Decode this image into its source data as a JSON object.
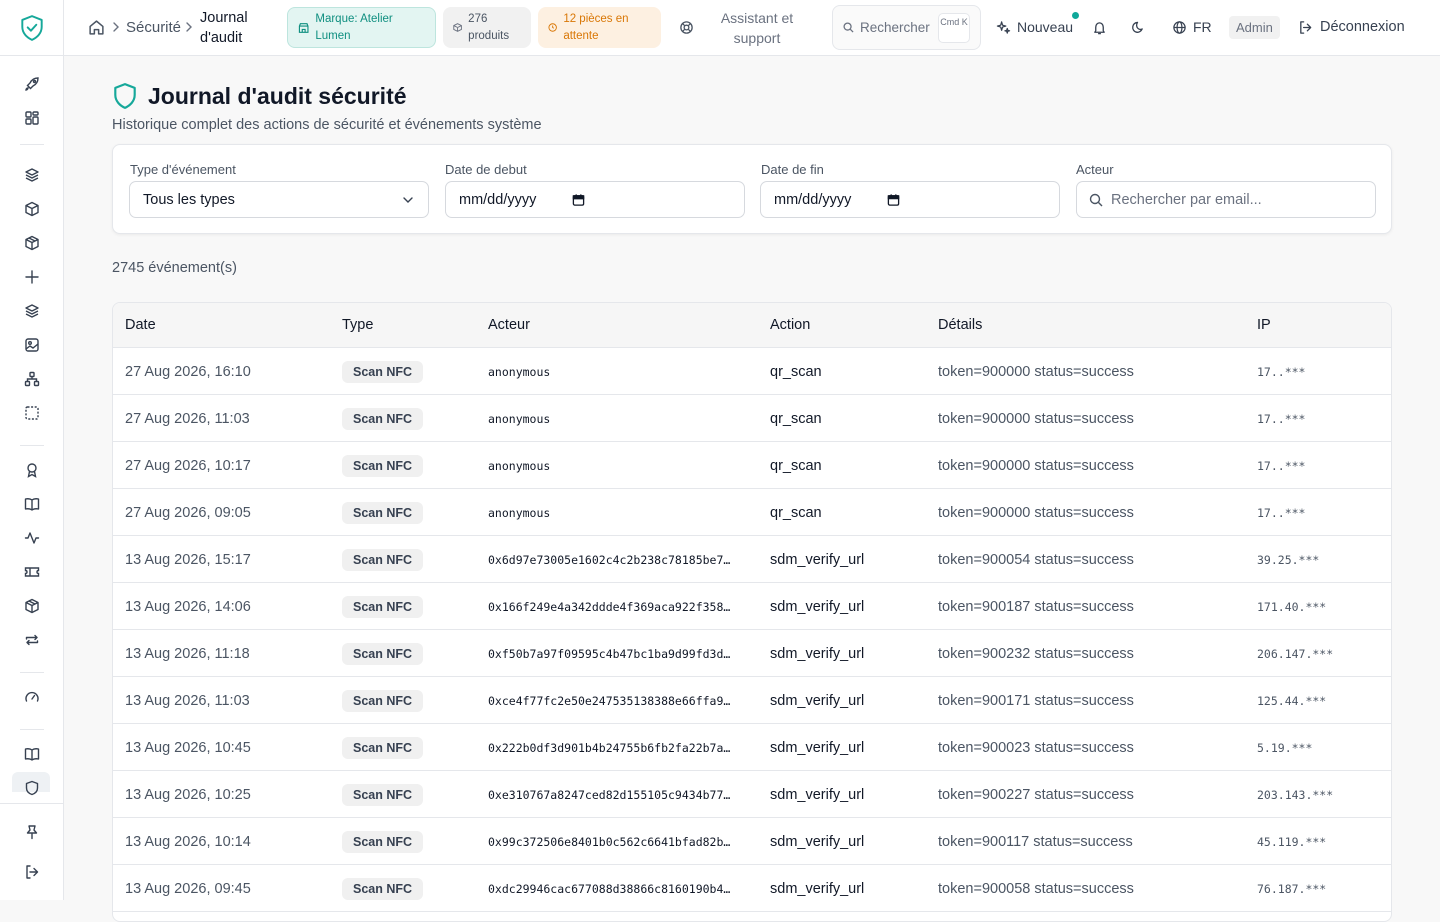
{
  "header": {
    "breadcrumb": [
      "Sécurité",
      "Journal d'audit"
    ],
    "brand_pill": "Marque: Atelier Lumen",
    "products_pill": "276 produits",
    "pending_pill": "12 pièces en attente",
    "support": "Assistant et support",
    "search": "Rechercher",
    "kbd": "Cmd K",
    "new": "Nouveau",
    "lang": "FR",
    "role": "Admin",
    "logout": "Déconnexion"
  },
  "sidebar": {
    "icons": [
      "rocket-icon",
      "dashboard-icon",
      "layers-icon",
      "box-icon",
      "package-icon",
      "plus-icon",
      "layers-icon",
      "image-icon",
      "network-icon",
      "scan-icon",
      "award-icon",
      "book-icon",
      "activity-icon",
      "ticket-icon",
      "package-icon",
      "repeat-icon",
      "gauge-icon",
      "book-open-icon",
      "shield-icon",
      "pin-icon",
      "logout-icon"
    ]
  },
  "page": {
    "title": "Journal d'audit sécurité",
    "subtitle": "Historique complet des actions de sécurité et événements système",
    "count": "2745 événement(s)"
  },
  "filters": {
    "type_label": "Type d'événement",
    "type_value": "Tous les types",
    "start_label": "Date de debut",
    "start_value": "mm/dd/yyyy",
    "end_label": "Date de fin",
    "end_value": "mm/dd/yyyy",
    "actor_label": "Acteur",
    "actor_placeholder": "Rechercher par email..."
  },
  "table": {
    "headers": [
      "Date",
      "Type",
      "Acteur",
      "Action",
      "Détails",
      "IP"
    ],
    "rows": [
      {
        "date": "27 Aug 2026, 16:10",
        "type": "Scan NFC",
        "actor": "anonymous",
        "action": "qr_scan",
        "details": "token=900000 status=success",
        "ip": "17..***"
      },
      {
        "date": "27 Aug 2026, 11:03",
        "type": "Scan NFC",
        "actor": "anonymous",
        "action": "qr_scan",
        "details": "token=900000 status=success",
        "ip": "17..***"
      },
      {
        "date": "27 Aug 2026, 10:17",
        "type": "Scan NFC",
        "actor": "anonymous",
        "action": "qr_scan",
        "details": "token=900000 status=success",
        "ip": "17..***"
      },
      {
        "date": "27 Aug 2026, 09:05",
        "type": "Scan NFC",
        "actor": "anonymous",
        "action": "qr_scan",
        "details": "token=900000 status=success",
        "ip": "17..***"
      },
      {
        "date": "13 Aug 2026, 15:17",
        "type": "Scan NFC",
        "actor": "0x6d97e73005e1602c4c2b238c78185be7…",
        "action": "sdm_verify_url",
        "details": "token=900054 status=success",
        "ip": "39.25.***"
      },
      {
        "date": "13 Aug 2026, 14:06",
        "type": "Scan NFC",
        "actor": "0x166f249e4a342ddde4f369aca922f358…",
        "action": "sdm_verify_url",
        "details": "token=900187 status=success",
        "ip": "171.40.***"
      },
      {
        "date": "13 Aug 2026, 11:18",
        "type": "Scan NFC",
        "actor": "0xf50b7a97f09595c4b47bc1ba9d99fd3d…",
        "action": "sdm_verify_url",
        "details": "token=900232 status=success",
        "ip": "206.147.***"
      },
      {
        "date": "13 Aug 2026, 11:03",
        "type": "Scan NFC",
        "actor": "0xce4f77fc2e50e247535138388e66ffa9…",
        "action": "sdm_verify_url",
        "details": "token=900171 status=success",
        "ip": "125.44.***"
      },
      {
        "date": "13 Aug 2026, 10:45",
        "type": "Scan NFC",
        "actor": "0x222b0df3d901b4b24755b6fb2fa22b7a…",
        "action": "sdm_verify_url",
        "details": "token=900023 status=success",
        "ip": "5.19.***"
      },
      {
        "date": "13 Aug 2026, 10:25",
        "type": "Scan NFC",
        "actor": "0xe310767a8247ced82d155105c9434b77…",
        "action": "sdm_verify_url",
        "details": "token=900227 status=success",
        "ip": "203.143.***"
      },
      {
        "date": "13 Aug 2026, 10:14",
        "type": "Scan NFC",
        "actor": "0x99c372506e8401b0c562c6641bfad82b…",
        "action": "sdm_verify_url",
        "details": "token=900117 status=success",
        "ip": "45.119.***"
      },
      {
        "date": "13 Aug 2026, 09:45",
        "type": "Scan NFC",
        "actor": "0xdc29946cac677088d38866c8160190b4…",
        "action": "sdm_verify_url",
        "details": "token=900058 status=success",
        "ip": "76.187.***"
      }
    ]
  }
}
